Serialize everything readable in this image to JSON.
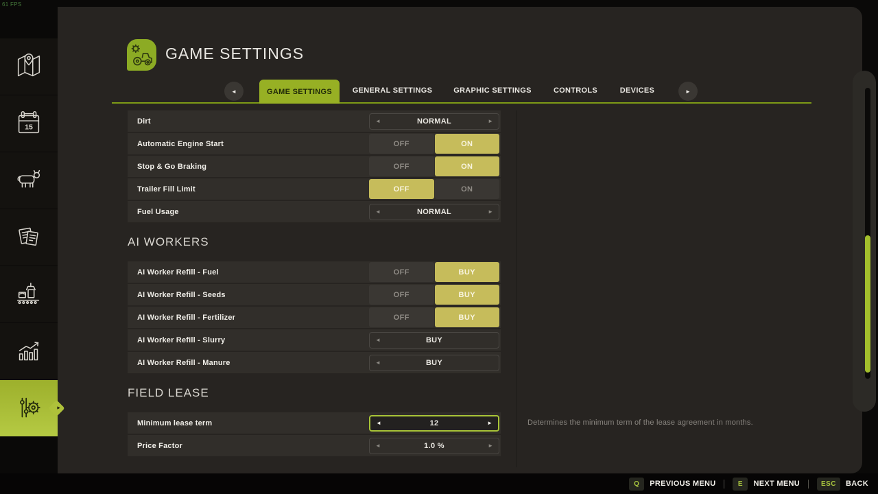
{
  "fps": "61 FPS",
  "header": {
    "title": "GAME SETTINGS"
  },
  "icons": {
    "left_arrow": "◄",
    "right_arrow": "►",
    "tab_prev": "◄",
    "tab_next": "►",
    "notch_arrow": "►"
  },
  "tabs": {
    "active_index": 0,
    "items": [
      "GAME SETTINGS",
      "GENERAL SETTINGS",
      "GRAPHIC SETTINGS",
      "CONTROLS",
      "DEVICES"
    ]
  },
  "sidebar": {
    "calendar_day": "15",
    "items": [
      {
        "name": "map"
      },
      {
        "name": "calendar"
      },
      {
        "name": "animals"
      },
      {
        "name": "finances"
      },
      {
        "name": "production"
      },
      {
        "name": "statistics"
      },
      {
        "name": "settings",
        "active": true
      }
    ]
  },
  "settings": {
    "general": {
      "rows": [
        {
          "label": "Dirt",
          "control": "selector",
          "value": "NORMAL"
        },
        {
          "label": "Automatic Engine Start",
          "control": "toggle",
          "options": [
            "OFF",
            "ON"
          ],
          "selected": "ON"
        },
        {
          "label": "Stop & Go Braking",
          "control": "toggle",
          "options": [
            "OFF",
            "ON"
          ],
          "selected": "ON"
        },
        {
          "label": "Trailer Fill Limit",
          "control": "toggle",
          "options": [
            "OFF",
            "ON"
          ],
          "selected": "OFF"
        },
        {
          "label": "Fuel Usage",
          "control": "selector",
          "value": "NORMAL"
        }
      ]
    },
    "ai_workers": {
      "title": "AI WORKERS",
      "rows": [
        {
          "label": "AI Worker Refill - Fuel",
          "control": "toggle",
          "options": [
            "OFF",
            "BUY"
          ],
          "selected": "BUY"
        },
        {
          "label": "AI Worker Refill - Seeds",
          "control": "toggle",
          "options": [
            "OFF",
            "BUY"
          ],
          "selected": "BUY"
        },
        {
          "label": "AI Worker Refill - Fertilizer",
          "control": "toggle",
          "options": [
            "OFF",
            "BUY"
          ],
          "selected": "BUY"
        },
        {
          "label": "AI Worker Refill - Slurry",
          "control": "selector",
          "value": "BUY",
          "arrows": "left-only"
        },
        {
          "label": "AI Worker Refill - Manure",
          "control": "selector",
          "value": "BUY",
          "arrows": "left-only"
        }
      ]
    },
    "field_lease": {
      "title": "FIELD LEASE",
      "rows": [
        {
          "label": "Minimum lease term",
          "control": "selector",
          "value": "12",
          "focused": true
        },
        {
          "label": "Price Factor",
          "control": "selector",
          "value": "1.0 %"
        }
      ]
    }
  },
  "tooltip": "Determines the minimum term of the lease agreement in months.",
  "bottom_bar": {
    "hints": [
      {
        "key": "Q",
        "label": "PREVIOUS MENU"
      },
      {
        "key": "E",
        "label": "NEXT MENU"
      },
      {
        "key": "ESC",
        "label": "BACK"
      }
    ]
  },
  "colors": {
    "accent_green": "#97b024",
    "sidebar_active_green": "#aec13a",
    "active_option_olive": "#c6bc5b",
    "focus_border": "#a8c437",
    "panel_bg": "#272421",
    "row_bg": "#312e2a",
    "scroll_thumb": "#a3bf2c",
    "key_text": "#a7c43e"
  }
}
